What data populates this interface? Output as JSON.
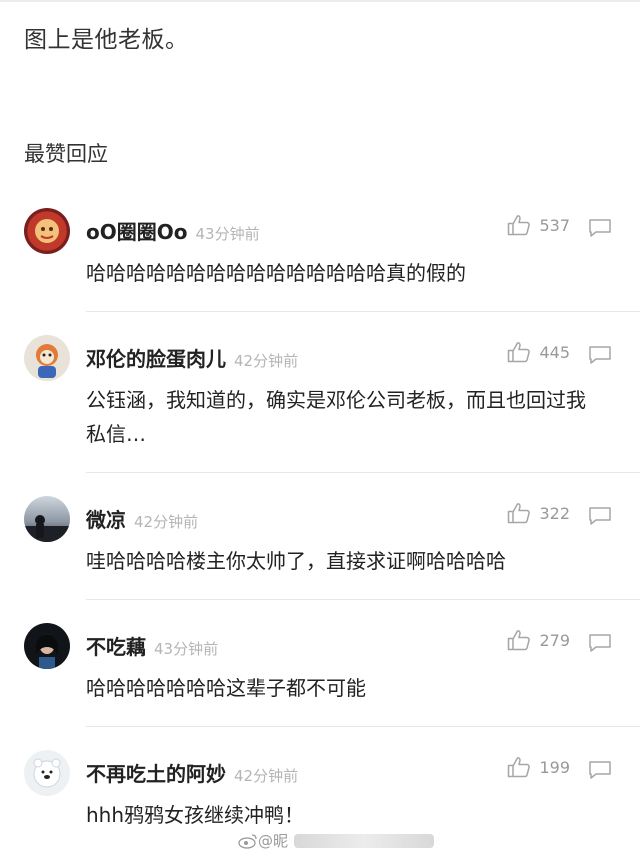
{
  "post": {
    "text": "图上是他老板。"
  },
  "section": {
    "title": "最赞回应"
  },
  "comments": [
    {
      "username": "oO圈圈Oo",
      "time": "43分钟前",
      "likes": "537",
      "text": "哈哈哈哈哈哈哈哈哈哈哈哈哈哈哈真的假的"
    },
    {
      "username": "邓伦的脸蛋肉儿",
      "time": "42分钟前",
      "likes": "445",
      "text": "公钰涵，我知道的，确实是邓伦公司老板，而且也回过我私信…"
    },
    {
      "username": "微凉",
      "time": "42分钟前",
      "likes": "322",
      "text": "哇哈哈哈哈楼主你太帅了，直接求证啊哈哈哈哈"
    },
    {
      "username": "不吃藕",
      "time": "43分钟前",
      "likes": "279",
      "text": "哈哈哈哈哈哈哈这辈子都不可能"
    },
    {
      "username": "不再吃土的阿妙",
      "time": "42分钟前",
      "likes": "199",
      "text": "hhh鸦鸦女孩继续冲鸭！"
    }
  ],
  "watermark": {
    "text": "@昵"
  }
}
